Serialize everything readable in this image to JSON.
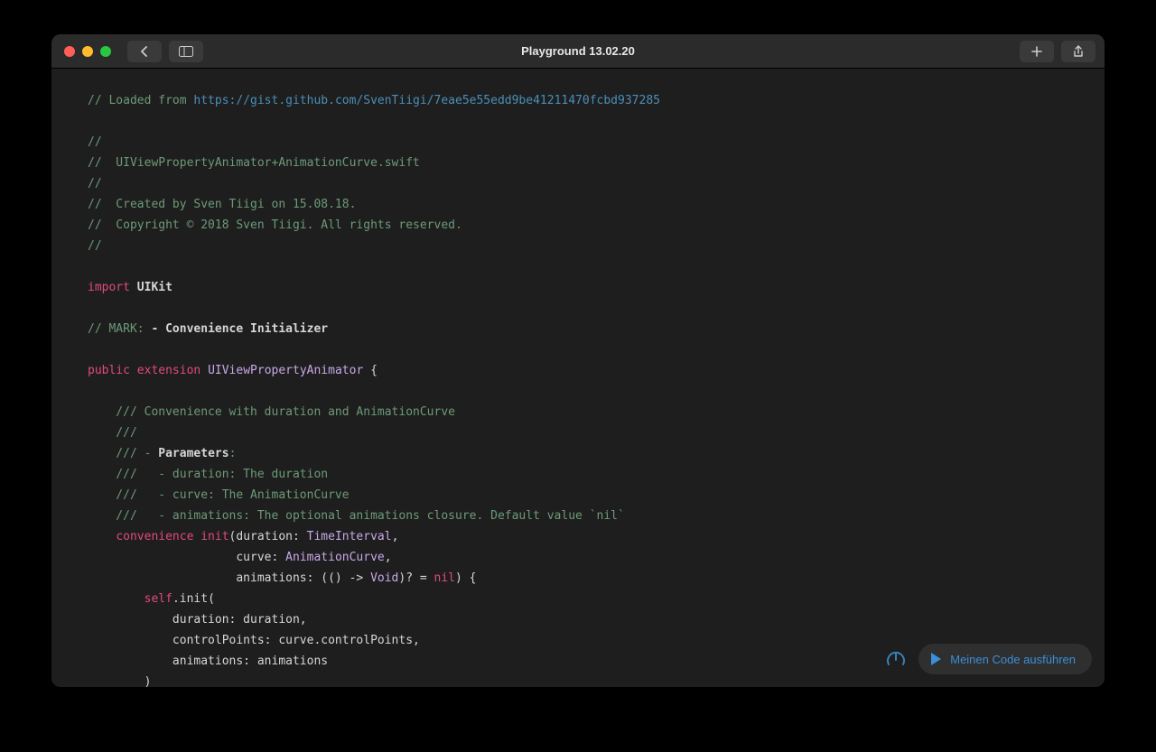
{
  "window": {
    "title": "Playground 13.02.20",
    "run_button_label": "Meinen Code ausführen"
  },
  "code": {
    "loaded_prefix": "// Loaded from ",
    "loaded_url": "https://gist.github.com/SvenTiigi/7eae5e55edd9be41211470fcbd937285",
    "header_lines": [
      "//",
      "//  UIViewPropertyAnimator+AnimationCurve.swift",
      "//",
      "//  Created by Sven Tiigi on 15.08.18.",
      "//  Copyright © 2018 Sven Tiigi. All rights reserved.",
      "//"
    ],
    "import_kw": "import",
    "import_module": "UIKit",
    "mark_prefix": "// MARK:",
    "mark_text": " - Convenience Initializer",
    "decl_public": "public",
    "decl_extension": "extension",
    "decl_type": "UIViewPropertyAnimator",
    "brace_open": " {",
    "doc_lines": [
      "    /// Convenience with duration and AnimationCurve",
      "    ///",
      "    /// - "
    ],
    "doc_param_label": "Parameters",
    "doc_colon": ":",
    "doc_params": [
      "    ///   - duration: The duration",
      "    ///   - curve: The AnimationCurve",
      "    ///   - animations: The optional animations closure. Default value `nil`"
    ],
    "conv_kw": "convenience",
    "init_kw": "init",
    "sig_open": "(duration: ",
    "t_timeinterval": "TimeInterval",
    "sig_c1": ",",
    "sig_l2_pad": "                     curve: ",
    "t_animcurve": "AnimationCurve",
    "sig_c2": ",",
    "sig_l3_pad": "                     animations: (() -> ",
    "t_void": "Void",
    "sig_l3_tail": ")? = ",
    "nil_kw": "nil",
    "sig_close": ") {",
    "self_kw": "self",
    "self_tail": ".init(",
    "body_lines": [
      "            duration: duration,",
      "            controlPoints: curve.controlPoints,",
      "            animations: animations"
    ],
    "body_close": "        )"
  }
}
